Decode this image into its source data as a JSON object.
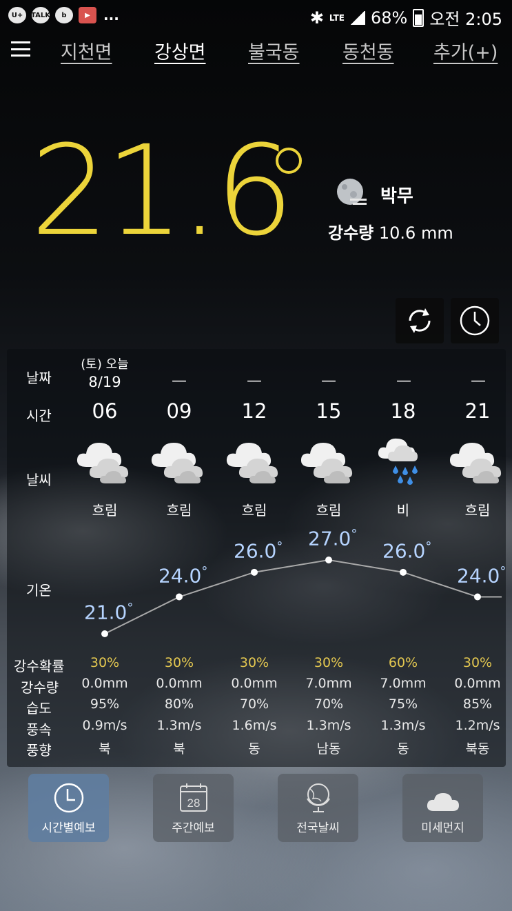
{
  "status_bar": {
    "left_icons": [
      "U+",
      "TALK",
      "b",
      "video"
    ],
    "overflow": "...",
    "network": "LTE",
    "battery": "68%",
    "time": "오전 2:05"
  },
  "tabs": [
    "지천면",
    "강상면",
    "불국동",
    "동천동",
    "추가(+)"
  ],
  "active_tab": 1,
  "current": {
    "temperature": "21.6",
    "condition": "박무",
    "precip_label": "강수량",
    "precip_value": "10.6 mm"
  },
  "colors": {
    "temp": "#ecd43a",
    "temp_label": "#b6d4ff",
    "pop": "#e3c750"
  },
  "row_labels": {
    "date": "날짜",
    "time": "시간",
    "weather": "날씨",
    "temp": "기온",
    "pop": "강수확률",
    "precip": "강수량",
    "humidity": "습도",
    "wind_speed": "풍속",
    "wind_dir": "풍향"
  },
  "first_date": {
    "day": "(토) 오늘",
    "date": "8/19"
  },
  "dash": "—",
  "hours": [
    {
      "hour": "06",
      "icon": "cloudy-icon",
      "desc": "흐림",
      "temp": "21.0",
      "temp_value": 21.0,
      "pop": "30%",
      "precip": "0.0mm",
      "humidity": "95%",
      "wind_speed": "0.9m/s",
      "wind_dir": "북"
    },
    {
      "hour": "09",
      "icon": "cloudy-icon",
      "desc": "흐림",
      "temp": "24.0",
      "temp_value": 24.0,
      "pop": "30%",
      "precip": "0.0mm",
      "humidity": "80%",
      "wind_speed": "1.3m/s",
      "wind_dir": "북"
    },
    {
      "hour": "12",
      "icon": "cloudy-icon",
      "desc": "흐림",
      "temp": "26.0",
      "temp_value": 26.0,
      "pop": "30%",
      "precip": "0.0mm",
      "humidity": "70%",
      "wind_speed": "1.6m/s",
      "wind_dir": "동"
    },
    {
      "hour": "15",
      "icon": "cloudy-icon",
      "desc": "흐림",
      "temp": "27.0",
      "temp_value": 27.0,
      "pop": "30%",
      "precip": "7.0mm",
      "humidity": "70%",
      "wind_speed": "1.3m/s",
      "wind_dir": "남동"
    },
    {
      "hour": "18",
      "icon": "rain-icon",
      "desc": "비",
      "temp": "26.0",
      "temp_value": 26.0,
      "pop": "60%",
      "precip": "7.0mm",
      "humidity": "75%",
      "wind_speed": "1.3m/s",
      "wind_dir": "동"
    },
    {
      "hour": "21",
      "icon": "cloudy-icon",
      "desc": "흐림",
      "temp": "24.0",
      "temp_value": 24.0,
      "pop": "30%",
      "precip": "0.0mm",
      "humidity": "85%",
      "wind_speed": "1.2m/s",
      "wind_dir": "북동"
    }
  ],
  "bottom_nav": [
    {
      "label": "시간별예보",
      "icon": "clock-icon",
      "active": true
    },
    {
      "label": "주간예보",
      "icon": "calendar-icon",
      "calendar_day": "28",
      "active": false
    },
    {
      "label": "전국날씨",
      "icon": "globe-icon",
      "active": false
    },
    {
      "label": "미세먼지",
      "icon": "cloud-icon",
      "active": false
    }
  ]
}
